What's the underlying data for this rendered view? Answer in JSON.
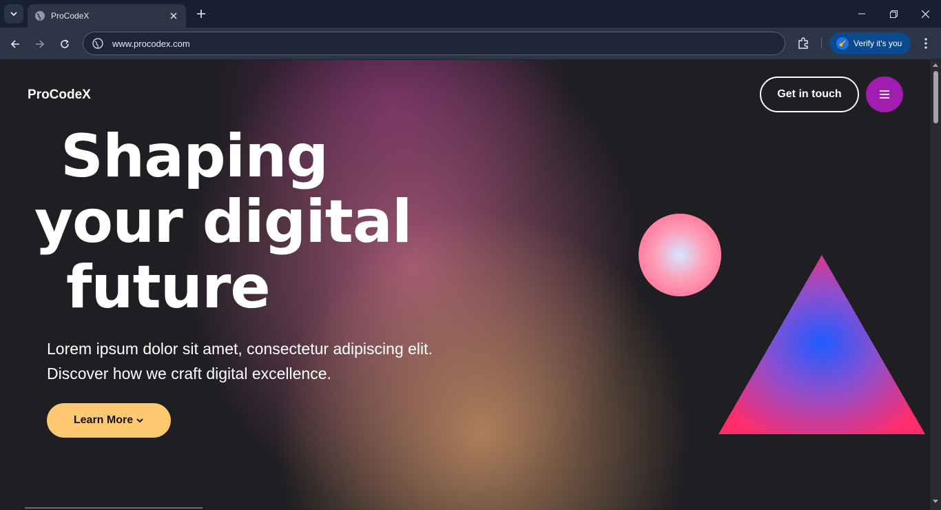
{
  "browser": {
    "tab_title": "ProCodeX",
    "url": "www.procodex.com",
    "verify_label": "Verify it's you"
  },
  "site": {
    "brand": "ProCodeX",
    "contact_label": "Get in touch",
    "headline_line1": "Shaping",
    "headline_line2": "your digital",
    "headline_line3": "future",
    "sub_line1": "Lorem ipsum dolor sit amet, consectetur adipiscing elit.",
    "sub_line2": "Discover how we craft digital excellence.",
    "learn_more_label": "Learn More"
  },
  "colors": {
    "accent_purple": "#a01db0",
    "cta_yellow": "#fcc970",
    "chrome_bg": "#172033"
  }
}
